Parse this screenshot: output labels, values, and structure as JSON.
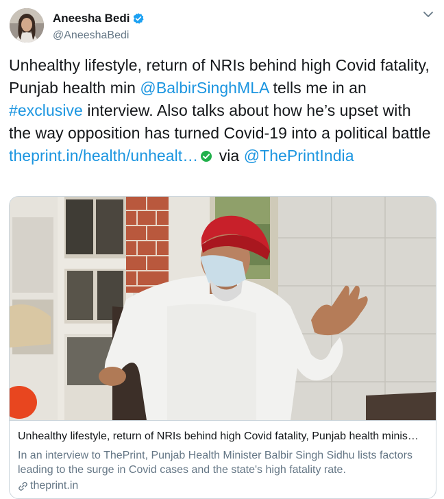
{
  "author": {
    "display_name": "Aneesha Bedi",
    "handle": "@AneeshaBedi",
    "verified": true
  },
  "tweet": {
    "part1": "Unhealthy lifestyle, return of NRIs behind high Covid fatality, Punjab health min ",
    "mention1": "@BalbirSinghMLA",
    "part2": " tells me in an ",
    "hashtag": "#exclusive",
    "part3": " interview. Also talks about how he’s upset with the way opposition has turned Covid-19 into a political battle ",
    "url": "theprint.in/health/unhealt…",
    "part4": " via ",
    "mention2": "@ThePrintIndia"
  },
  "card": {
    "title": "Unhealthy lifestyle, return of NRIs behind high Covid fatality, Punjab health minis…",
    "description": "In an interview to ThePrint, Punjab Health Minister Balbir Singh Sidhu lists factors leading to the surge in Covid cases and the state's high fatality rate.",
    "domain": "theprint.in"
  },
  "icons": {
    "verified": "verified-badge-icon",
    "menu": "chevron-down-icon",
    "link_check": "check-circle-icon",
    "link": "link-icon"
  },
  "colors": {
    "link": "#1b95e0",
    "secondary_text": "#657786",
    "verified": "#1da1f2",
    "check": "#21b04b",
    "turban": "#c8202a"
  }
}
